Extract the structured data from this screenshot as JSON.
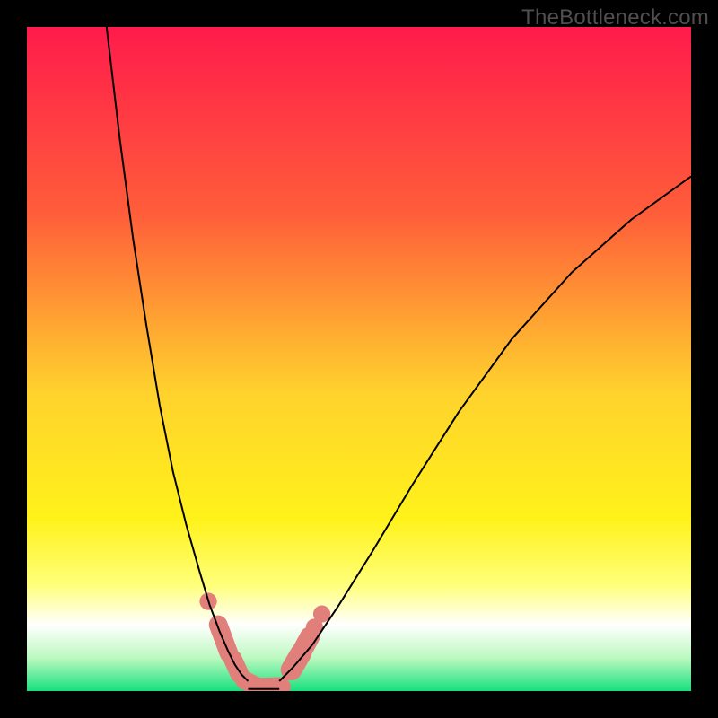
{
  "watermark": "TheBottleneck.com",
  "chart_data": {
    "type": "line",
    "title": "",
    "xlabel": "",
    "ylabel": "",
    "xlim": [
      0,
      100
    ],
    "ylim": [
      0,
      100
    ],
    "grid": false,
    "legend": false,
    "background_gradient_stops": [
      {
        "pct": 0,
        "color": "#ff1b4b"
      },
      {
        "pct": 28,
        "color": "#ff5d3a"
      },
      {
        "pct": 55,
        "color": "#ffd22d"
      },
      {
        "pct": 74,
        "color": "#fff21a"
      },
      {
        "pct": 84,
        "color": "#ffff7a"
      },
      {
        "pct": 90,
        "color": "#ffffff"
      },
      {
        "pct": 95,
        "color": "#bcf9c0"
      },
      {
        "pct": 100,
        "color": "#17e07d"
      }
    ],
    "curve_left": {
      "type": "line",
      "x": [
        12.0,
        14.0,
        16.0,
        18.0,
        20.0,
        22.0,
        24.0,
        26.0,
        27.5,
        29.0,
        30.3,
        31.3,
        32.3,
        33.3
      ],
      "y": [
        100.0,
        83.0,
        68.0,
        55.0,
        43.0,
        33.0,
        25.0,
        18.0,
        13.0,
        9.0,
        6.0,
        4.0,
        2.5,
        1.5
      ]
    },
    "curve_right": {
      "type": "line",
      "x": [
        38.0,
        40.0,
        43.0,
        47.0,
        52.0,
        58.0,
        65.0,
        73.0,
        82.0,
        91.0,
        100.0
      ],
      "y": [
        1.5,
        3.5,
        7.0,
        13.0,
        21.0,
        31.0,
        42.0,
        53.0,
        63.0,
        71.0,
        77.5
      ]
    },
    "valley_floor": {
      "x0": 33.3,
      "x1": 38.0,
      "y": 0.3
    },
    "markers": [
      {
        "shape": "circle",
        "x": 27.3,
        "y": 13.5,
        "r": 1.3
      },
      {
        "shape": "capsule",
        "x0": 28.8,
        "y0": 10.0,
        "x1": 30.4,
        "y1": 5.7,
        "r": 1.4
      },
      {
        "shape": "capsule",
        "x0": 31.0,
        "y0": 4.8,
        "x1": 32.0,
        "y1": 2.6,
        "r": 1.4
      },
      {
        "shape": "capsule",
        "x0": 32.8,
        "y0": 1.6,
        "x1": 35.0,
        "y1": 0.5,
        "r": 1.4
      },
      {
        "shape": "capsule",
        "x0": 35.0,
        "y0": 0.5,
        "x1": 38.2,
        "y1": 0.6,
        "r": 1.5
      },
      {
        "shape": "capsule",
        "x0": 39.8,
        "y0": 3.2,
        "x1": 41.2,
        "y1": 5.6,
        "r": 1.6
      },
      {
        "shape": "capsule",
        "x0": 41.2,
        "y0": 5.6,
        "x1": 42.6,
        "y1": 8.2,
        "r": 1.5
      },
      {
        "shape": "circle",
        "x": 43.3,
        "y": 9.6,
        "r": 1.3
      },
      {
        "shape": "circle",
        "x": 44.4,
        "y": 11.6,
        "r": 1.3
      }
    ],
    "marker_color": "#e17f7b",
    "curve_color": "#000000"
  }
}
